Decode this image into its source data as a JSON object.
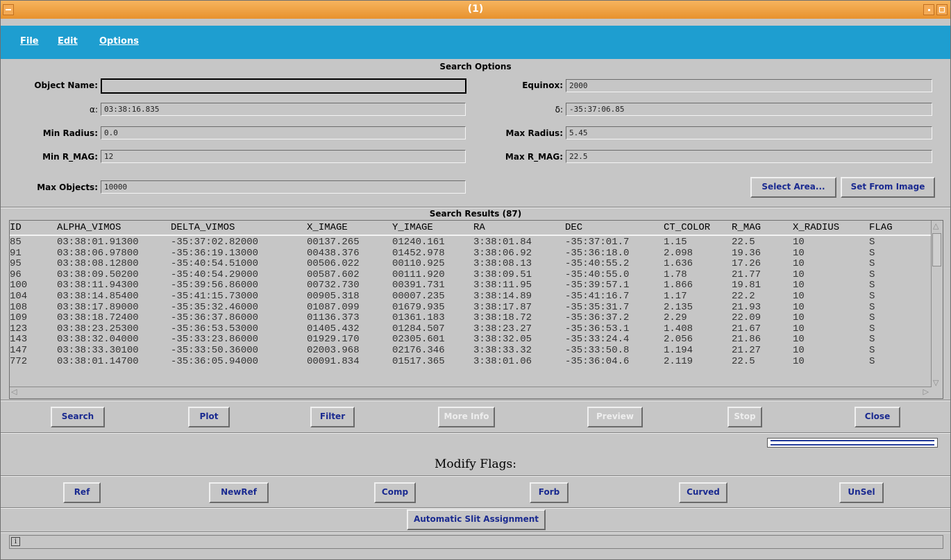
{
  "window": {
    "title": "(1)"
  },
  "menu": {
    "file": "File",
    "edit": "Edit",
    "options": "Options"
  },
  "search_options": {
    "title": "Search Options",
    "object_name": {
      "label": "Object Name:",
      "value": ""
    },
    "equinox": {
      "label": "Equinox:",
      "value": "2000"
    },
    "alpha": {
      "label": "α:",
      "value": "03:38:16.835"
    },
    "delta": {
      "label": "δ:",
      "value": "-35:37:06.85"
    },
    "min_radius": {
      "label": "Min Radius:",
      "value": "0.0"
    },
    "max_radius": {
      "label": "Max Radius:",
      "value": "5.45"
    },
    "min_rmag": {
      "label": "Min R_MAG:",
      "value": "12"
    },
    "max_rmag": {
      "label": "Max R_MAG:",
      "value": "22.5"
    },
    "max_objects": {
      "label": "Max Objects:",
      "value": "10000"
    },
    "select_area": "Select Area...",
    "set_from_image": "Set From Image"
  },
  "results": {
    "title": "Search Results (87)",
    "columns": [
      "ID",
      "ALPHA_VIMOS",
      "DELTA_VIMOS",
      "X_IMAGE",
      "Y_IMAGE",
      "RA",
      "DEC",
      "CT_COLOR",
      "R_MAG",
      "X_RADIUS",
      "FLAG"
    ],
    "rows": [
      [
        "85",
        "03:38:01.91300",
        "-35:37:02.82000",
        "00137.265",
        "01240.161",
        "3:38:01.84",
        "-35:37:01.7",
        "1.15",
        "22.5",
        "10",
        "S"
      ],
      [
        "91",
        "03:38:06.97800",
        "-35:36:19.13000",
        "00438.376",
        "01452.978",
        "3:38:06.92",
        "-35:36:18.0",
        "2.098",
        "19.36",
        "10",
        "S"
      ],
      [
        "95",
        "03:38:08.12800",
        "-35:40:54.51000",
        "00506.022",
        "00110.925",
        "3:38:08.13",
        "-35:40:55.2",
        "1.636",
        "17.26",
        "10",
        "S"
      ],
      [
        "96",
        "03:38:09.50200",
        "-35:40:54.29000",
        "00587.602",
        "00111.920",
        "3:38:09.51",
        "-35:40:55.0",
        "1.78",
        "21.77",
        "10",
        "S"
      ],
      [
        "100",
        "03:38:11.94300",
        "-35:39:56.86000",
        "00732.730",
        "00391.731",
        "3:38:11.95",
        "-35:39:57.1",
        "1.866",
        "19.81",
        "10",
        "S"
      ],
      [
        "104",
        "03:38:14.85400",
        "-35:41:15.73000",
        "00905.318",
        "00007.235",
        "3:38:14.89",
        "-35:41:16.7",
        "1.17",
        "22.2",
        "10",
        "S"
      ],
      [
        "108",
        "03:38:17.89000",
        "-35:35:32.46000",
        "01087.099",
        "01679.935",
        "3:38:17.87",
        "-35:35:31.7",
        "2.135",
        "21.93",
        "10",
        "S"
      ],
      [
        "109",
        "03:38:18.72400",
        "-35:36:37.86000",
        "01136.373",
        "01361.183",
        "3:38:18.72",
        "-35:36:37.2",
        "2.29",
        "22.09",
        "10",
        "S"
      ],
      [
        "123",
        "03:38:23.25300",
        "-35:36:53.53000",
        "01405.432",
        "01284.507",
        "3:38:23.27",
        "-35:36:53.1",
        "1.408",
        "21.67",
        "10",
        "S"
      ],
      [
        "143",
        "03:38:32.04000",
        "-35:33:23.86000",
        "01929.170",
        "02305.601",
        "3:38:32.05",
        "-35:33:24.4",
        "2.056",
        "21.86",
        "10",
        "S"
      ],
      [
        "147",
        "03:38:33.30100",
        "-35:33:50.36000",
        "02003.968",
        "02176.346",
        "3:38:33.32",
        "-35:33:50.8",
        "1.194",
        "21.27",
        "10",
        "S"
      ],
      [
        "772",
        "03:38:01.14700",
        "-35:36:05.94000",
        "00091.834",
        "01517.365",
        "3:38:01.06",
        "-35:36:04.6",
        "2.119",
        "22.5",
        "10",
        "S"
      ]
    ]
  },
  "actions": {
    "search": "Search",
    "plot": "Plot",
    "filter": "Filter",
    "more_info": "More Info",
    "preview": "Preview",
    "stop": "Stop",
    "close": "Close"
  },
  "modify_flags": {
    "title": "Modify Flags:",
    "ref": "Ref",
    "newref": "NewRef",
    "comp": "Comp",
    "forb": "Forb",
    "curved": "Curved",
    "unsel": "UnSel"
  },
  "automatic_slit": "Automatic Slit Assignment",
  "status": {
    "info_icon": "i"
  }
}
